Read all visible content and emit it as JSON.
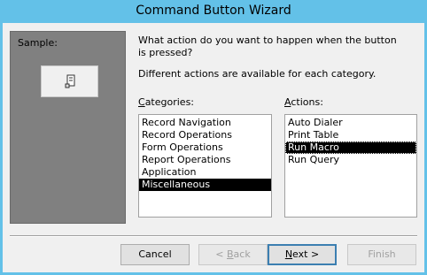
{
  "window": {
    "title": "Command Button Wizard"
  },
  "sample": {
    "label": "Sample:",
    "icon": "runmacro-icon"
  },
  "prompt": {
    "question": "What action do you want to happen when the button is pressed?",
    "info": "Different actions are available for each category."
  },
  "categories": {
    "label_underlined": "C",
    "label_rest": "ategories:",
    "items": [
      "Record Navigation",
      "Record Operations",
      "Form Operations",
      "Report Operations",
      "Application",
      "Miscellaneous"
    ],
    "selected": "Miscellaneous"
  },
  "actions": {
    "label_underlined": "A",
    "label_rest": "ctions:",
    "items": [
      "Auto Dialer",
      "Print Table",
      "Run Macro",
      "Run Query"
    ],
    "selected": "Run Macro"
  },
  "buttons": {
    "cancel": "Cancel",
    "back_mnemonic": "B",
    "back_prefix": "< ",
    "back_rest": "ack",
    "next_mnemonic": "N",
    "next_rest": "ext >",
    "finish": "Finish"
  }
}
